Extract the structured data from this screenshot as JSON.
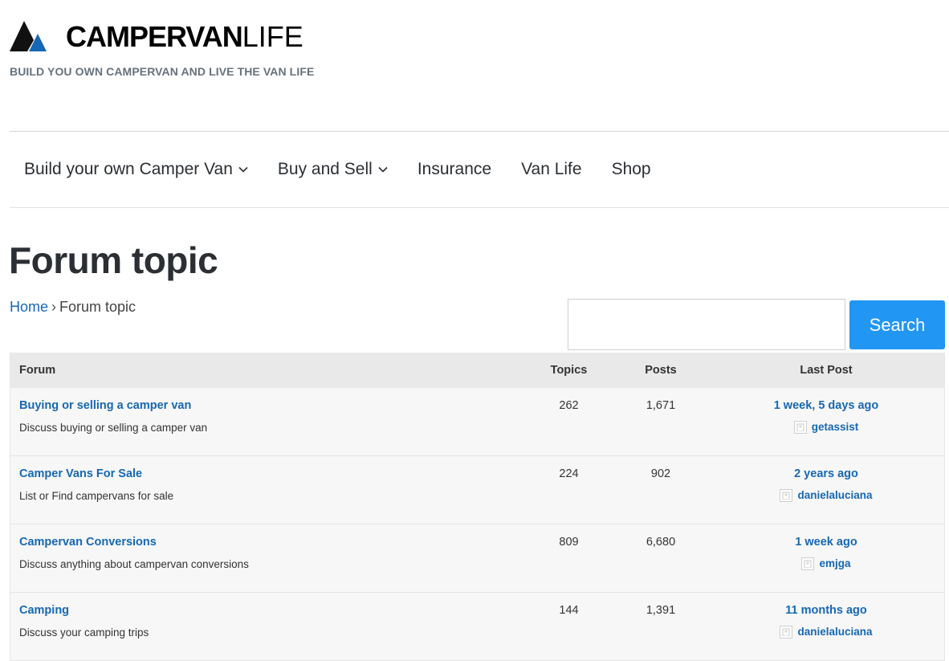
{
  "site": {
    "logo_bold": "CAMPERVAN",
    "logo_light": "LIFE",
    "tagline": "BUILD YOU OWN CAMPERVAN AND LIVE THE VAN LIFE"
  },
  "nav": {
    "items": [
      {
        "label": "Build your own Camper Van",
        "has_dropdown": true
      },
      {
        "label": "Buy and Sell",
        "has_dropdown": true
      },
      {
        "label": "Insurance",
        "has_dropdown": false
      },
      {
        "label": "Van Life",
        "has_dropdown": false
      },
      {
        "label": "Shop",
        "has_dropdown": false
      }
    ]
  },
  "page": {
    "title": "Forum topic"
  },
  "breadcrumb": {
    "home": "Home",
    "separator": "›",
    "current": "Forum topic"
  },
  "search": {
    "value": "",
    "button_label": "Search"
  },
  "table": {
    "headers": {
      "forum": "Forum",
      "topics": "Topics",
      "posts": "Posts",
      "last_post": "Last Post"
    },
    "rows": [
      {
        "title": "Buying or selling a camper van",
        "description": "Discuss buying or selling a camper van",
        "topics": "262",
        "posts": "1,671",
        "last_time": "1 week, 5 days ago",
        "last_user": "getassist"
      },
      {
        "title": "Camper Vans For Sale",
        "description": "List or Find campervans for sale",
        "topics": "224",
        "posts": "902",
        "last_time": "2 years ago",
        "last_user": "danielaluciana"
      },
      {
        "title": "Campervan Conversions",
        "description": "Discuss anything about campervan conversions",
        "topics": "809",
        "posts": "6,680",
        "last_time": "1 week ago",
        "last_user": "emjga"
      },
      {
        "title": "Camping",
        "description": "Discuss your camping trips",
        "topics": "144",
        "posts": "1,391",
        "last_time": "11 months ago",
        "last_user": "danielaluciana"
      }
    ]
  },
  "colors": {
    "link": "#1668b4",
    "button": "#2196f3",
    "logo_black": "#000000",
    "logo_blue": "#1668b4"
  },
  "icons": {
    "logo": "mountain-logo-icon",
    "dropdown": "chevron-down-icon",
    "avatar": "default-avatar-icon"
  }
}
